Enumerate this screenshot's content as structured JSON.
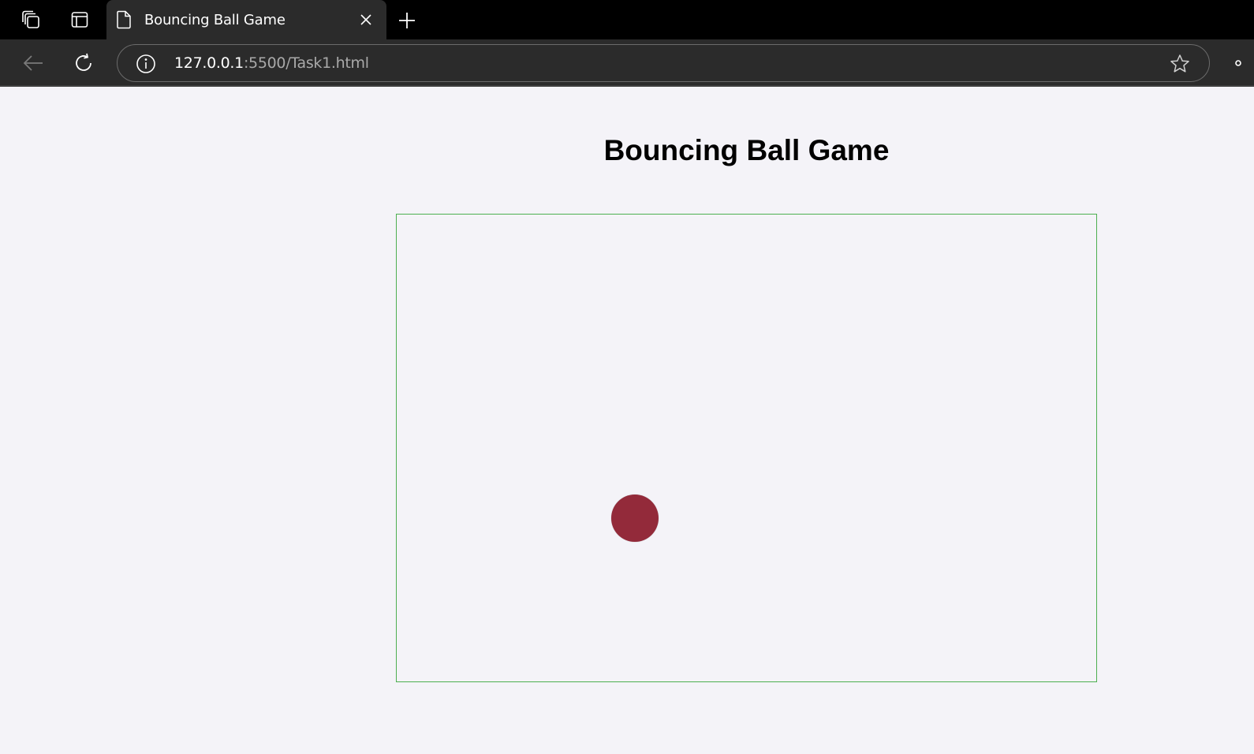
{
  "browser": {
    "tab": {
      "title": "Bouncing Ball Game"
    },
    "address_bar": {
      "host": "127.0.0.1",
      "rest": ":5500/Task1.html"
    }
  },
  "page": {
    "title": "Bouncing Ball Game",
    "ball_color": "#932a3a",
    "border_color": "#4caf50"
  }
}
